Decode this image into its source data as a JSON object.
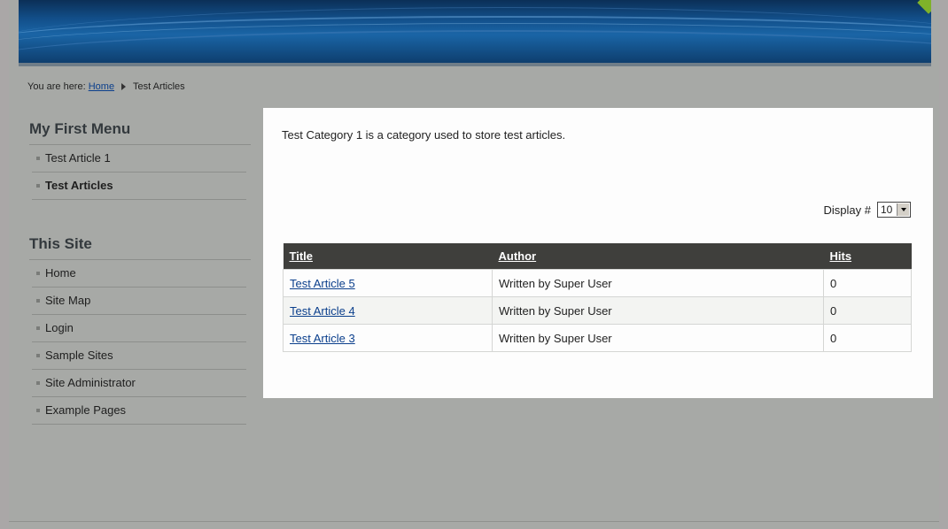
{
  "breadcrumb": {
    "prefix": "You are here:",
    "home": "Home",
    "current": "Test Articles"
  },
  "sidebar": {
    "menu1": {
      "title": "My First Menu",
      "items": [
        {
          "label": "Test Article 1",
          "active": false
        },
        {
          "label": "Test Articles",
          "active": true
        }
      ]
    },
    "menu2": {
      "title": "This Site",
      "items": [
        {
          "label": "Home"
        },
        {
          "label": "Site Map"
        },
        {
          "label": "Login"
        },
        {
          "label": "Sample Sites"
        },
        {
          "label": "Site Administrator"
        },
        {
          "label": "Example Pages"
        }
      ]
    }
  },
  "content": {
    "category_description": "Test Category 1 is a category used to store test articles.",
    "display_label": "Display #",
    "display_value": "10",
    "table": {
      "headers": [
        "Title",
        "Author",
        "Hits"
      ],
      "rows": [
        {
          "title": "Test Article 5",
          "author": "Written by Super User",
          "hits": "0"
        },
        {
          "title": "Test Article 4",
          "author": "Written by Super User",
          "hits": "0"
        },
        {
          "title": "Test Article 3",
          "author": "Written by Super User",
          "hits": "0"
        }
      ]
    }
  },
  "colors": {
    "background": "#a7a9a6",
    "banner": "#124f8a",
    "header_row": "#3f3f3c",
    "link": "#0b3f8c",
    "accent": "#7fb22a"
  }
}
